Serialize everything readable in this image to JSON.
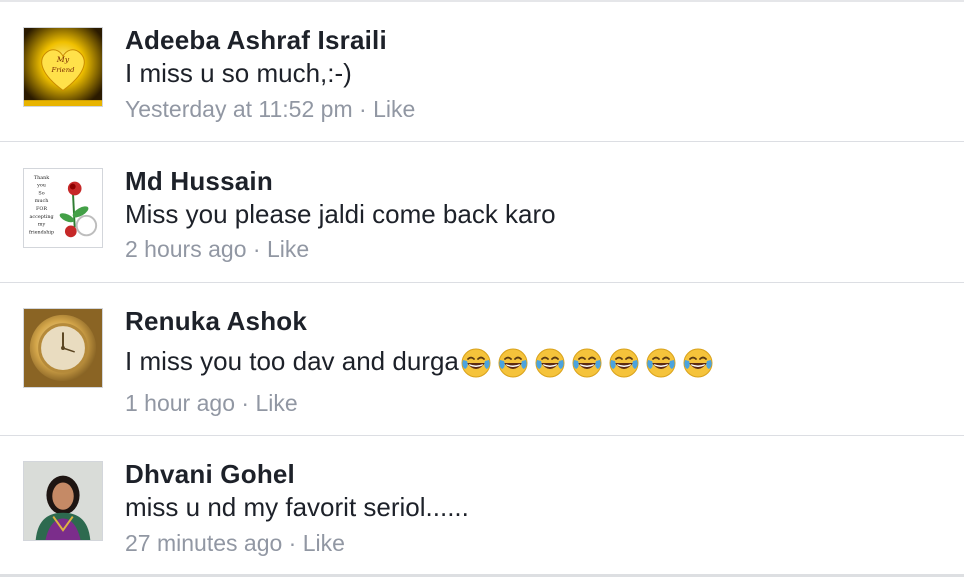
{
  "comments": [
    {
      "name": "Adeeba Ashraf Israili",
      "text": "I miss u so much,:-)",
      "time": "Yesterday at 11:52 pm",
      "separator": "·",
      "like": "Like",
      "avatar_text": [
        "My",
        "Friend"
      ]
    },
    {
      "name": "Md Hussain",
      "text": "Miss you please jaldi come back karo",
      "time": "2 hours ago",
      "separator": "·",
      "like": "Like",
      "avatar_text": [
        "Thank",
        "you",
        "So",
        "much",
        "FOR",
        "accepting",
        "my",
        "friendship"
      ]
    },
    {
      "name": "Renuka Ashok",
      "text": "I miss you too dav and durga",
      "emoji_count": 7,
      "emoji_icon": "tears-of-joy-emoji",
      "time": "1 hour ago",
      "separator": "·",
      "like": "Like"
    },
    {
      "name": "Dhvani Gohel",
      "text": "miss u nd my favorit seriol......",
      "time": "27 minutes ago",
      "separator": "·",
      "like": "Like"
    }
  ],
  "colors": {
    "name_text": "#1d2129",
    "meta_text": "#9197a3",
    "divider": "#dcdee3"
  }
}
